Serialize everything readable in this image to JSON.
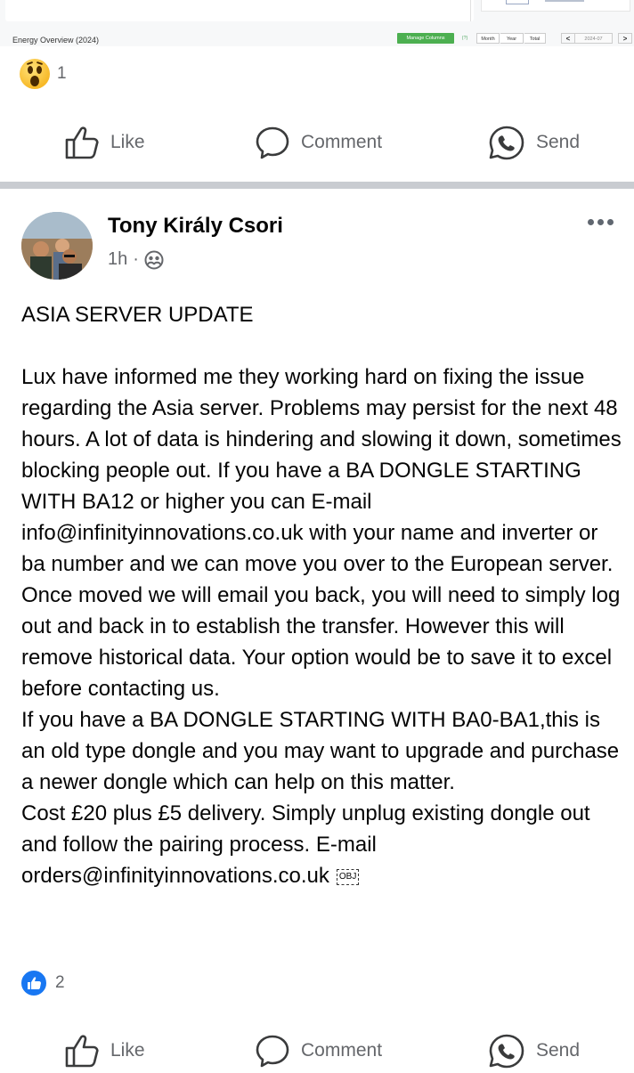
{
  "dashboard": {
    "title": "Energy Overview (2024)",
    "manage_columns": "Manage Columns",
    "help": "(?)",
    "tabs": [
      "Month",
      "Year",
      "Total"
    ],
    "prev": "<",
    "date": "2024-07",
    "next": ">",
    "accent_color": "#4caf50"
  },
  "prev_post": {
    "reaction": {
      "icon": "wow-emoji-icon",
      "count": "1"
    },
    "actions": {
      "like": "Like",
      "comment": "Comment",
      "send": "Send"
    }
  },
  "post": {
    "author": "Tony Király Csori",
    "time": "1h",
    "separator": "·",
    "audience_icon": "friends-icon",
    "body": "ASIA SERVER UPDATE\n\nLux have informed me they working hard on fixing the issue regarding the Asia server. Problems may persist for the next 48 hours. A lot of data is hindering and slowing it down, sometimes blocking people out. If you have a BA DONGLE STARTING WITH BA12 or higher you can E-mail info@infinityinnovations.co.uk  with your name and inverter or ba number and we can move you over to the European server.  Once moved we will email you back, you will need to simply log out and back in to establish the transfer. However this will remove historical data. Your option would be to save it to excel before contacting us.\nIf you have a BA DONGLE STARTING WITH BA0-BA1,this is an old type dongle and you may want to upgrade and purchase a newer dongle  which can help on this matter.\nCost £20 plus £5 delivery. Simply unplug existing dongle out and follow the pairing process. E-mail orders@infinityinnovations.co.uk",
    "obj_marker": "OBJ",
    "reaction": {
      "icon": "like-badge-icon",
      "count": "2",
      "color": "#1877f2"
    },
    "actions": {
      "like": "Like",
      "comment": "Comment",
      "send": "Send"
    }
  }
}
